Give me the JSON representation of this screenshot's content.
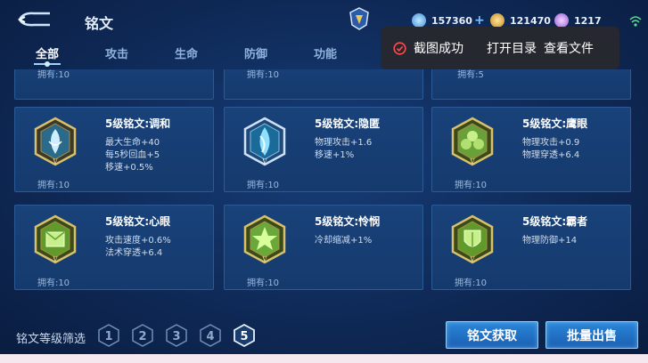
{
  "header": {
    "title": "铭文",
    "currencies": [
      {
        "name": "diamond",
        "value": "157360",
        "icon": "diamond-icon",
        "color": "#8fd0ff",
        "has_plus": true
      },
      {
        "name": "gold",
        "value": "121470",
        "icon": "gold-coin-icon",
        "color": "#e9b84a",
        "has_plus": false
      },
      {
        "name": "gem",
        "value": "1217",
        "icon": "purple-gem-icon",
        "color": "#c78cff",
        "has_plus": false
      }
    ]
  },
  "tabs": [
    {
      "label": "全部",
      "active": true
    },
    {
      "label": "攻击",
      "active": false
    },
    {
      "label": "生命",
      "active": false
    },
    {
      "label": "防御",
      "active": false
    },
    {
      "label": "功能",
      "active": false
    }
  ],
  "toast": {
    "message": "截图成功",
    "open_label": "打开目录",
    "view_label": "查看文件"
  },
  "cards": [
    {
      "name": "",
      "attrs": [],
      "owned": "拥有:10",
      "icon": "",
      "partial": true
    },
    {
      "name": "",
      "attrs": [],
      "owned": "拥有:10",
      "icon": "",
      "partial": true
    },
    {
      "name": "",
      "attrs": [],
      "owned": "拥有:5",
      "icon": "",
      "partial": true
    },
    {
      "name": "5级铭文:调和",
      "attrs": [
        "最大生命+40",
        "每5秒回血+5",
        "移速+0.5%"
      ],
      "owned": "拥有:10",
      "icon": "rune-tiaohe-icon",
      "color": "#d9c06a"
    },
    {
      "name": "5级铭文:隐匿",
      "attrs": [
        "物理攻击+1.6",
        "移速+1%"
      ],
      "owned": "拥有:10",
      "icon": "rune-yinni-icon",
      "color": "#8fd8ff"
    },
    {
      "name": "5级铭文:鹰眼",
      "attrs": [
        "物理攻击+0.9",
        "物理穿透+6.4"
      ],
      "owned": "拥有:10",
      "icon": "rune-yingyan-icon",
      "color": "#9fd55a"
    },
    {
      "name": "5级铭文:心眼",
      "attrs": [
        "攻击速度+0.6%",
        "法术穿透+6.4"
      ],
      "owned": "拥有:10",
      "icon": "rune-xinyan-icon",
      "color": "#9fd55a"
    },
    {
      "name": "5级铭文:怜悯",
      "attrs": [
        "冷却缩减+1%"
      ],
      "owned": "拥有:10",
      "icon": "rune-lianmin-icon",
      "color": "#a8e05a"
    },
    {
      "name": "5级铭文:霸者",
      "attrs": [
        "物理防御+14"
      ],
      "owned": "拥有:10",
      "icon": "rune-bazhe-icon",
      "color": "#9fd55a"
    }
  ],
  "footer": {
    "filter_label": "铭文等级筛选",
    "levels": [
      "1",
      "2",
      "3",
      "4",
      "5"
    ],
    "selected_level": "5",
    "acquire_label": "铭文获取",
    "sell_label": "批量出售"
  }
}
